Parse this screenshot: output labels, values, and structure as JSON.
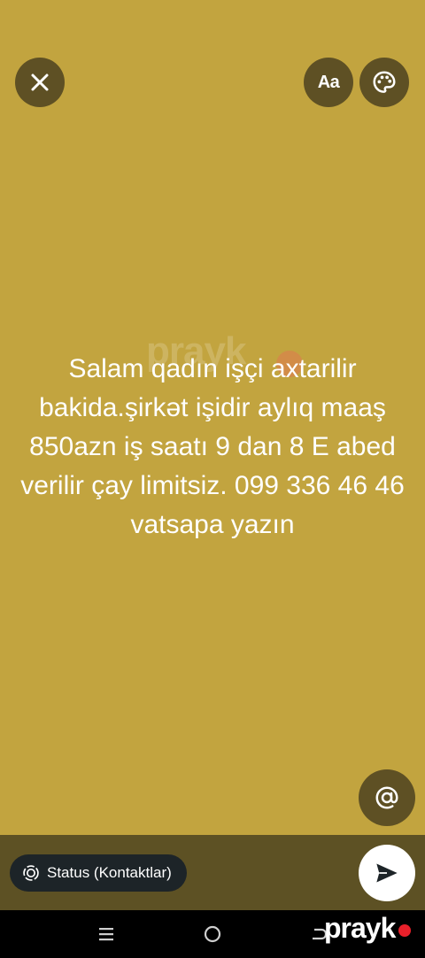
{
  "header": {
    "close_icon": "close-icon",
    "font_button_label": "Aa",
    "palette_icon": "palette-icon"
  },
  "status": {
    "text": "Salam qadın işçi axtarilir bakida.şirkət işidir aylıq maaş 850azn iş saatı 9 dan 8 E abed verilir çay limitsiz. 099 336 46 46 vatsapa yazın",
    "background_color": "#c2a43f"
  },
  "mention_icon": "at-icon",
  "composer": {
    "audience_label": "Status (Kontaktlar)",
    "audience_icon": "status-ring-icon",
    "send_icon": "send-icon",
    "bar_color": "#5d5124"
  },
  "watermark": {
    "center_text": "prayk",
    "brand_text": "prayk",
    "brand_dot_color": "#e8202a"
  },
  "navigation": {
    "recent_icon": "recent-apps-icon",
    "home_icon": "home-icon",
    "back_icon": "back-icon"
  }
}
